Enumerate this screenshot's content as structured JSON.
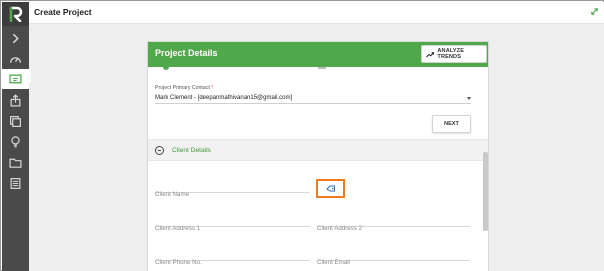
{
  "window": {
    "title": "Create Project"
  },
  "sidebar": {
    "items": [
      {
        "icon": "chevron-right-icon",
        "active": false
      },
      {
        "icon": "gauge-icon",
        "active": false
      },
      {
        "icon": "project-screen-icon",
        "active": true
      },
      {
        "icon": "upload-icon",
        "active": false
      },
      {
        "icon": "layers-icon",
        "active": false
      },
      {
        "icon": "lightbulb-icon",
        "active": false
      },
      {
        "icon": "folder-icon",
        "active": false
      },
      {
        "icon": "list-icon",
        "active": false
      }
    ]
  },
  "dialog": {
    "title": "Project Details",
    "analyze_label": "ANALYZE TRENDS",
    "primary_contact": {
      "label": "Project Primary Contact",
      "required_mark": "*",
      "value": "Mark Clement - [deepanmathivanan15@gmail.com]"
    },
    "next_label": "NEXT",
    "client_section": {
      "title": "Client Details",
      "fields": {
        "client_name": "Client Name",
        "client_address_1": "Client Address 1",
        "client_address_2": "Client Address 2",
        "client_phone": "Client Phone No.",
        "client_email": "Client Email"
      }
    }
  },
  "colors": {
    "accent_green": "#4fa84a",
    "highlight_orange": "#f07b1e",
    "sidebar_bg": "#4a4a4a"
  }
}
